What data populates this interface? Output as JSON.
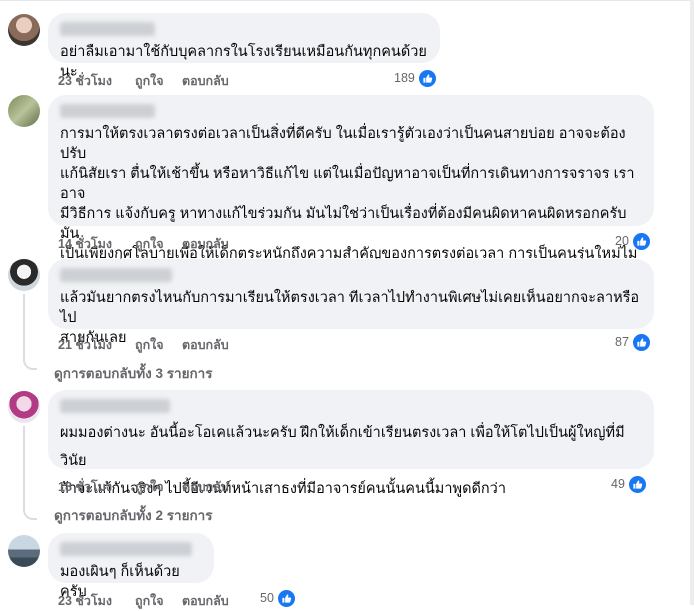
{
  "comments": [
    {
      "text": "อย่าลืมเอามาใช้กับบุคลากรในโรงเรียนเหมือนกันทุกคนด้วยนะ",
      "time": "23 ชั่วโมง",
      "like_label": "ถูกใจ",
      "reply_label": "ตอบกลับ",
      "reaction_count": "189"
    },
    {
      "text": "การมาให้ตรงเวลาตรงต่อเวลาเป็นสิ่งที่ดีครับ ในเมื่อเรารู้ตัวเองว่าเป็นคนสายบ่อย อาจจะต้องปรับ\nแก้นิสัยเรา ตื่นให้เช้าขึ้น หรือหาวิธีแก้ไข แต่ในเมื่อปัญหาอาจเป็นที่การเดินทางการจราจร เราอาจ\nมีวิธีการ แจ้งกับครู หาทางแก้ไขร่วมกัน มันไม่ใช่ว่าเป็นเรื่องที่ต้องมีคนผิดหาคนผิดหรอกครับ มัน\nเป็นเพียงกุศโลบายเพื่อให้เด็กตระหนักถึงความสำคัญของการตรงต่อเวลา การเป็นคนรุ่นใหม่ไม่\nจำเป็นต้องสงสัยหรือคิดว่า เราฉลาดในทุกเรื่องก็ได้ครับ",
      "time": "14 ชั่วโมง",
      "like_label": "ถูกใจ",
      "reply_label": "ตอบกลับ",
      "reaction_count": "20"
    },
    {
      "text": "แล้วมันยากตรงไหนกับการมาเรียนให้ตรงเวลา ทีเวลาไปทำงานพิเศษไม่เคยเห็นอยากจะลาหรือไป\nสายกันเลย",
      "time": "21 ชั่วโมง",
      "like_label": "ถูกใจ",
      "reply_label": "ตอบกลับ",
      "reaction_count": "87",
      "replies_link": "ดูการตอบกลับทั้ง 3 รายการ"
    },
    {
      "text": "ผมมองต่างนะ อันนี้อะโอเคแล้วนะครับ ฝึกให้เด็กเข้าเรียนตรงเวลา เพื่อให้โตไปเป็นผู้ใหญ่ที่มีวินัย\nถ้าจะแก้กันจริงๆ ไปจี้อีเวนท์หน้าเสาธงที่มีอาจารย์คนนั้นคนนี้มาพูดดีกว่า",
      "time": "18 ชั่วโมง",
      "like_label": "ถูกใจ",
      "reply_label": "ตอบกลับ",
      "reaction_count": "49",
      "replies_link": "ดูการตอบกลับทั้ง 2 รายการ"
    },
    {
      "text": "มองเผินๆ ก็เห็นด้วยครับ",
      "time": "23 ชั่วโมง",
      "like_label": "ถูกใจ",
      "reply_label": "ตอบกลับ",
      "reaction_count": "50"
    }
  ],
  "colors": {
    "bubble": "#f0f2f5",
    "like_blue": "#1877f2",
    "meta_gray": "#65676b"
  },
  "icons": {
    "reaction": "like-thumbs-up-icon"
  }
}
